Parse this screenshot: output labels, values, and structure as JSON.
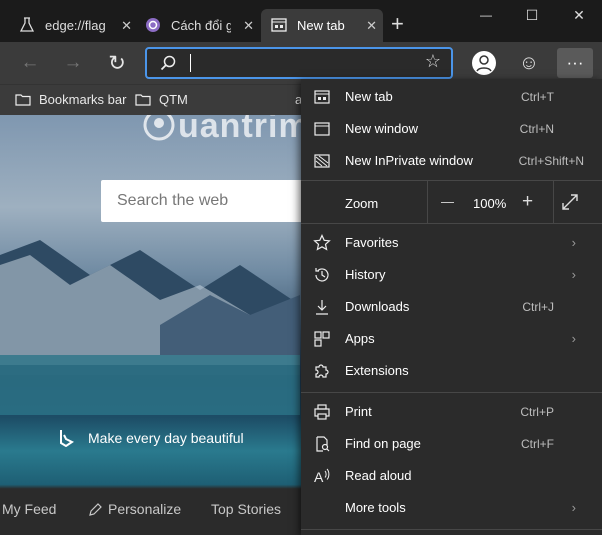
{
  "tabs": [
    {
      "label": "edge://flag",
      "icon": "flask-icon"
    },
    {
      "label": "Cách đổi gi",
      "icon": "quantrimang-icon"
    },
    {
      "label": "New tab",
      "icon": "newtab-icon"
    }
  ],
  "new_tab_symbol": "+",
  "window_controls": {
    "minimize": "—",
    "maximize": "☐",
    "close": "✕"
  },
  "toolbar": {
    "back": "←",
    "forward": "→",
    "refresh": "↻",
    "address_value": "",
    "favorite": "☆",
    "emoji": "☺",
    "more": "···"
  },
  "bookmarks": [
    {
      "label": "Bookmarks bar"
    },
    {
      "label": "QTM"
    },
    {
      "label": "al"
    }
  ],
  "watermark": "uantrimang",
  "search": {
    "placeholder": "Search the web"
  },
  "tagline": "Make every day beautiful",
  "feed": [
    "My Feed",
    "Personalize",
    "Top Stories"
  ],
  "menu": {
    "new_tab": {
      "label": "New tab",
      "shortcut": "Ctrl+T"
    },
    "new_window": {
      "label": "New window",
      "shortcut": "Ctrl+N"
    },
    "inprivate": {
      "label": "New InPrivate window",
      "shortcut": "Ctrl+Shift+N"
    },
    "zoom": {
      "label": "Zoom",
      "minus": "—",
      "value": "100%",
      "plus": "+"
    },
    "favorites": {
      "label": "Favorites"
    },
    "history": {
      "label": "History"
    },
    "downloads": {
      "label": "Downloads",
      "shortcut": "Ctrl+J"
    },
    "apps": {
      "label": "Apps"
    },
    "extensions": {
      "label": "Extensions"
    },
    "print": {
      "label": "Print",
      "shortcut": "Ctrl+P"
    },
    "find": {
      "label": "Find on page",
      "shortcut": "Ctrl+F"
    },
    "read_aloud": {
      "label": "Read aloud"
    },
    "more_tools": {
      "label": "More tools"
    }
  },
  "colors": {
    "accent": "#4b95e9",
    "menu_bg": "#2b2b2b",
    "toolbar_bg": "#3b3b3b",
    "tabstrip_bg": "#1b1b1b"
  }
}
